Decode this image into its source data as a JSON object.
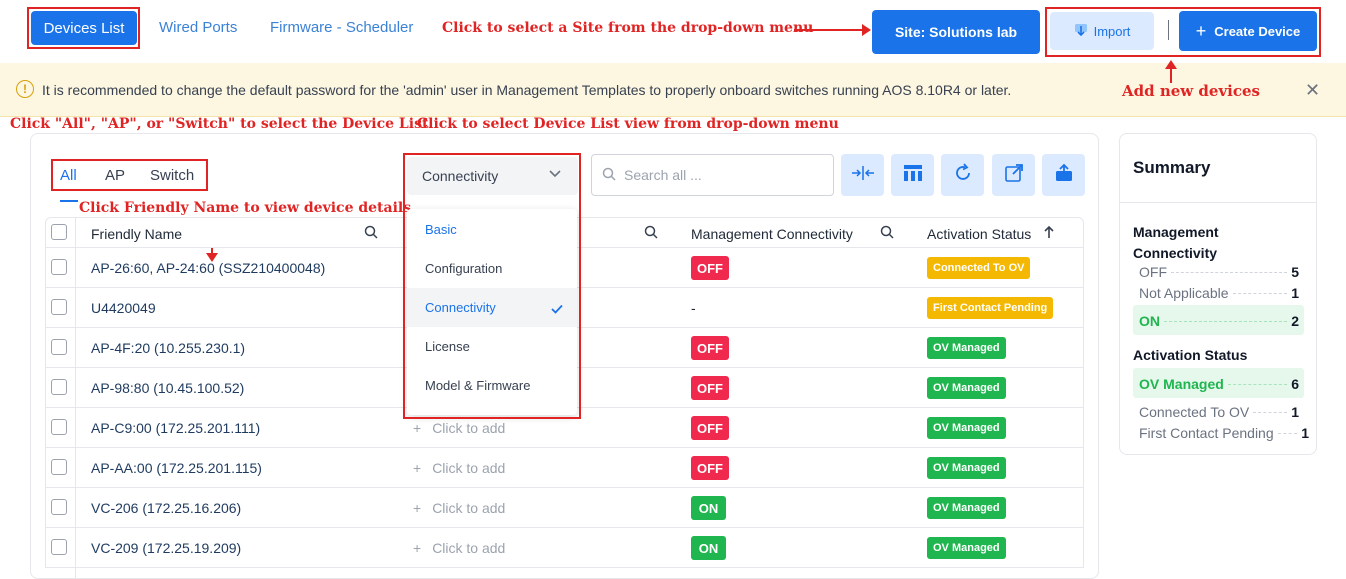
{
  "nav": {
    "tabs": [
      {
        "label": "Devices List"
      },
      {
        "label": "Wired Ports"
      },
      {
        "label": "Firmware - Scheduler"
      }
    ],
    "site_button": "Site:  Solutions lab",
    "import_button": "Import",
    "create_button": "Create Device"
  },
  "annotations": {
    "site": "Click to select a Site from the drop-down menu",
    "add": "Add new devices",
    "filter": "Click \"All\", \"AP\", or \"Switch\" to select the Device List",
    "view": "Click to select Device List view from drop-down menu",
    "friendly": "Click Friendly Name to view device details"
  },
  "banner": {
    "text": "It is recommended to change the default password for the 'admin' user in Management Templates to properly onboard switches running AOS 8.10R4 or later."
  },
  "filters": [
    "All",
    "AP",
    "Switch"
  ],
  "view_select": "Connectivity",
  "search": {
    "placeholder": "Search all ..."
  },
  "dropdown": {
    "items": [
      "Basic",
      "Configuration",
      "Connectivity",
      "License",
      "Model & Firmware"
    ],
    "selected": "Connectivity"
  },
  "table": {
    "headers": {
      "friendly_name": "Friendly Name",
      "mgmt": "Management Connectivity",
      "activation": "Activation Status"
    },
    "click_add": "Click to add",
    "rows": [
      {
        "name": "AP-26:60, AP-24:60 (SSZ210400048)",
        "mgmt": "OFF",
        "status": "Connected To OV"
      },
      {
        "name": "U4420049",
        "mgmt": "-",
        "status": "First Contact Pending"
      },
      {
        "name": "AP-4F:20 (10.255.230.1)",
        "mgmt": "OFF",
        "status": "OV Managed"
      },
      {
        "name": "AP-98:80 (10.45.100.52)",
        "mgmt": "OFF",
        "status": "OV Managed"
      },
      {
        "name": "AP-C9:00 (172.25.201.111)",
        "mgmt": "OFF",
        "status": "OV Managed"
      },
      {
        "name": "AP-AA:00 (172.25.201.115)",
        "mgmt": "OFF",
        "status": "OV Managed"
      },
      {
        "name": "VC-206 (172.25.16.206)",
        "mgmt": "ON",
        "status": "OV Managed"
      },
      {
        "name": "VC-209 (172.25.19.209)",
        "mgmt": "ON",
        "status": "OV Managed"
      }
    ]
  },
  "summary": {
    "title": "Summary",
    "mgmt_heading": "Management Connectivity",
    "mgmt": [
      {
        "label": "OFF",
        "count": "5"
      },
      {
        "label": "Not Applicable",
        "count": "1"
      },
      {
        "label": "ON",
        "count": "2"
      }
    ],
    "activation_heading": "Activation Status",
    "activation": [
      {
        "label": "OV Managed",
        "count": "6"
      },
      {
        "label": "Connected To OV",
        "count": "1"
      },
      {
        "label": "First Contact Pending",
        "count": "1"
      }
    ]
  },
  "colors": {
    "primary": "#1a73e8",
    "off": "#f0294f",
    "on": "#1fb54f",
    "pending": "#f5b800",
    "annotation": "#e02424"
  }
}
